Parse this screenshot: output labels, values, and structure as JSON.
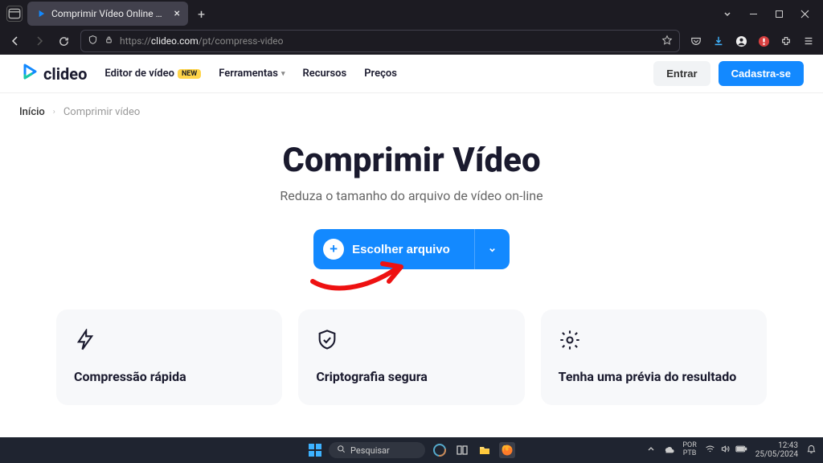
{
  "browser": {
    "tab": {
      "title": "Comprimir Vídeo Online — Di"
    },
    "url": {
      "prefix": "https://",
      "domain": "clideo.com",
      "path": "/pt/compress-video"
    }
  },
  "header": {
    "brand": "clideo",
    "nav": {
      "editor": "Editor de vídeo",
      "new_badge": "NEW",
      "tools": "Ferramentas",
      "resources": "Recursos",
      "prices": "Preços"
    },
    "login": "Entrar",
    "signup": "Cadastra-se"
  },
  "breadcrumb": {
    "home": "Início",
    "current": "Comprimir vídeo"
  },
  "hero": {
    "title": "Comprimir Vídeo",
    "subtitle": "Reduza o tamanho do arquivo de vídeo on-line",
    "choose_label": "Escolher arquivo"
  },
  "features": [
    {
      "title": "Compressão rápida"
    },
    {
      "title": "Criptografia segura"
    },
    {
      "title": "Tenha uma prévia do resultado"
    }
  ],
  "taskbar": {
    "search_placeholder": "Pesquisar",
    "lang_top": "POR",
    "lang_bot": "PTB",
    "time": "12:43",
    "date": "25/05/2024"
  }
}
